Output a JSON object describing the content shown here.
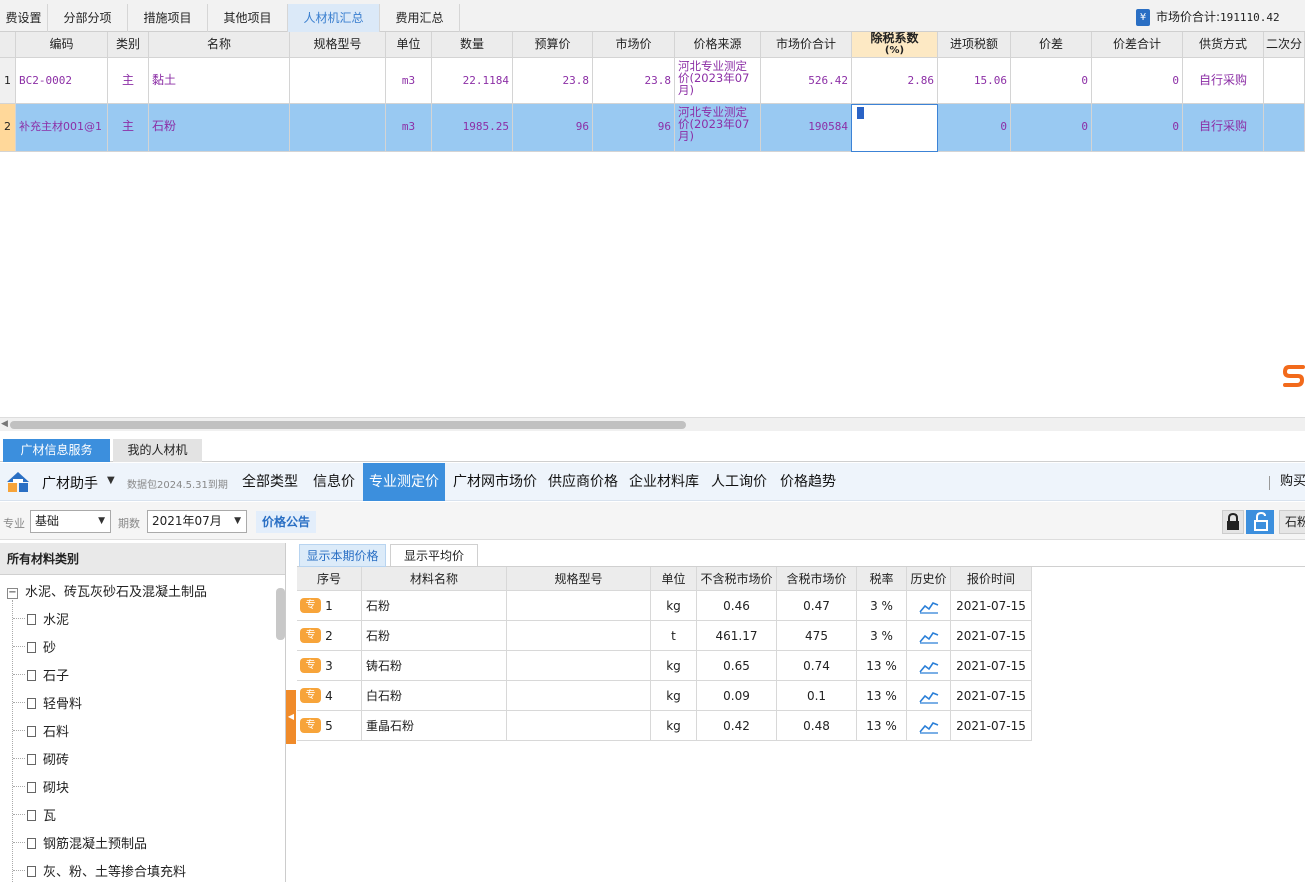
{
  "top_tabs": [
    "费设置",
    "分部分项",
    "措施项目",
    "其他项目",
    "人材机汇总",
    "费用汇总"
  ],
  "top_active_tab": 4,
  "market_total": {
    "label": "市场价合计:",
    "value": "191110.42",
    "icon_glyph": "¥"
  },
  "grid": {
    "headers": [
      "编码",
      "类别",
      "名称",
      "规格型号",
      "单位",
      "数量",
      "预算价",
      "市场价",
      "价格来源",
      "市场价合计",
      "除税系数",
      "进项税额",
      "价差",
      "价差合计",
      "供货方式",
      "二次分"
    ],
    "tax_header": {
      "line1": "除税系数",
      "line2": "(%)"
    },
    "rows": [
      {
        "no": "1",
        "code": "BC2-0002",
        "type": "主",
        "name": "黏土",
        "spec": "",
        "unit": "m3",
        "qty": "22.1184",
        "budget": "23.8",
        "market": "23.8",
        "source": "河北专业测定价(2023年07月)",
        "market_total": "526.42",
        "tax_rate": "2.86",
        "input_tax": "15.06",
        "diff": "0",
        "diff_total": "0",
        "supply": "自行采购"
      },
      {
        "no": "2",
        "code": "补充主材001@1",
        "type": "主",
        "name": "石粉",
        "spec": "",
        "unit": "m3",
        "qty": "1985.25",
        "budget": "96",
        "market": "96",
        "source": "河北专业测定价(2023年07月)",
        "market_total": "190584",
        "tax_rate": "",
        "input_tax": "0",
        "diff": "0",
        "diff_total": "0",
        "supply": "自行采购"
      }
    ]
  },
  "lower_tabs": [
    "广材信息服务",
    "我的人材机"
  ],
  "assistant": {
    "name": "广材助手",
    "data_package": "数据包2024.5.31到期",
    "nav": [
      "全部类型",
      "信息价",
      "专业测定价",
      "广材网市场价",
      "供应商价格",
      "企业材料库",
      "人工询价",
      "价格趋势"
    ],
    "active_nav": 2,
    "buy_label": "购买"
  },
  "filters": {
    "specialty_label": "专业",
    "specialty_value": "基础",
    "period_label": "期数",
    "period_value": "2021年07月",
    "notice_label": "价格公告",
    "search_value": "石粉"
  },
  "tree": {
    "header": "所有材料类别",
    "root": "水泥、砖瓦灰砂石及混凝土制品",
    "root_toggle": "−",
    "items": [
      "水泥",
      "砂",
      "石子",
      "轻骨料",
      "石料",
      "砌砖",
      "砌块",
      "瓦",
      "钢筋混凝土预制品",
      "灰、粉、土等掺合填充料"
    ]
  },
  "price_tabs": [
    "显示本期价格",
    "显示平均价"
  ],
  "price_table": {
    "headers": [
      "序号",
      "材料名称",
      "规格型号",
      "单位",
      "不含税市场价",
      "含税市场价",
      "税率",
      "历史价",
      "报价时间"
    ],
    "badge": "专",
    "rows": [
      {
        "no": "1",
        "name": "石粉",
        "spec": "",
        "unit": "kg",
        "ex_tax": "0.46",
        "inc_tax": "0.47",
        "rate": "3 %",
        "date": "2021-07-15"
      },
      {
        "no": "2",
        "name": "石粉",
        "spec": "",
        "unit": "t",
        "ex_tax": "461.17",
        "inc_tax": "475",
        "rate": "3 %",
        "date": "2021-07-15"
      },
      {
        "no": "3",
        "name": "铸石粉",
        "spec": "",
        "unit": "kg",
        "ex_tax": "0.65",
        "inc_tax": "0.74",
        "rate": "13 %",
        "date": "2021-07-15"
      },
      {
        "no": "4",
        "name": "白石粉",
        "spec": "",
        "unit": "kg",
        "ex_tax": "0.09",
        "inc_tax": "0.1",
        "rate": "13 %",
        "date": "2021-07-15"
      },
      {
        "no": "5",
        "name": "重晶石粉",
        "spec": "",
        "unit": "kg",
        "ex_tax": "0.42",
        "inc_tax": "0.48",
        "rate": "13 %",
        "date": "2021-07-15"
      }
    ]
  },
  "colors": {
    "accent": "#3c8fdd",
    "selection": "#99c9f2",
    "purple_text": "#8c2fa6",
    "orange": "#f7a43a"
  }
}
